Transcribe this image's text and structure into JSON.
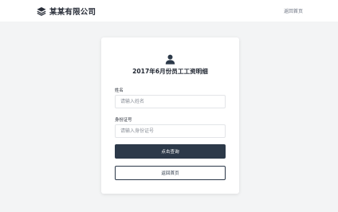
{
  "header": {
    "brand_name": "某某有限公司",
    "home_link": "返回首页"
  },
  "card": {
    "title": "2017年6月份员工工资明细",
    "name_label": "姓名",
    "name_placeholder": "请输入姓名",
    "id_label": "身份证号",
    "id_placeholder": "请输入身份证号",
    "query_button": "点击查询",
    "back_button": "返回首页"
  }
}
